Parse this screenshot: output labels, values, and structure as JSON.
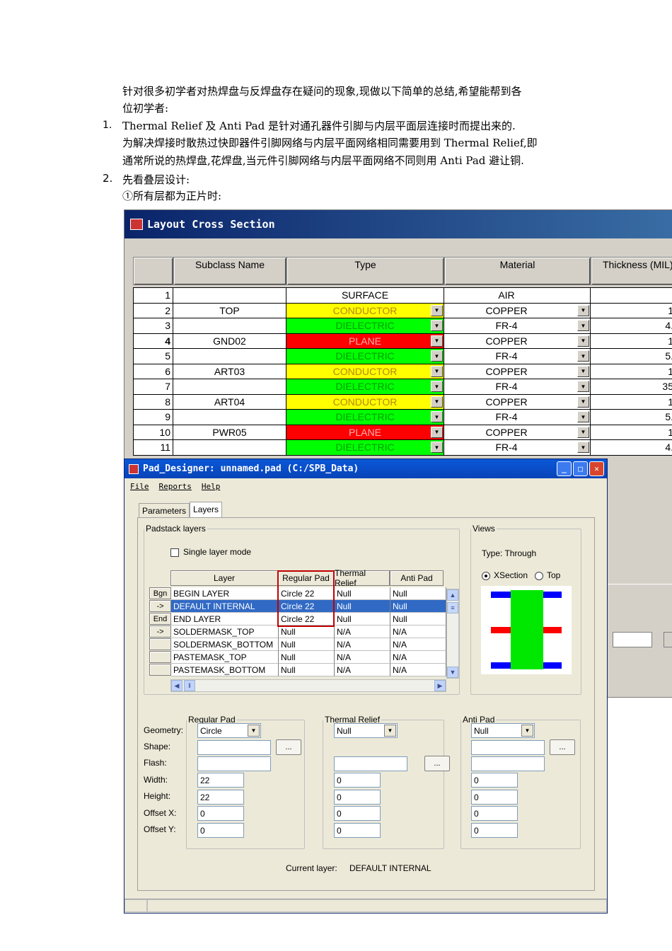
{
  "doc": {
    "line1": "针对很多初学者对热焊盘与反焊盘存在疑问的现象,现做以下简单的总结,希望能帮到各",
    "line2": "位初学者:",
    "item1_num": "1.",
    "item1_text": "Thermal Relief 及 Anti Pad 是针对通孔器件引脚与内层平面层连接时而提出来的.",
    "item1_line2": "为解决焊接时散热过快即器件引脚网络与内层平面网络相同需要用到 Thermal Relief,即",
    "item1_line3": "通常所说的热焊盘,花焊盘,当元件引脚网络与内层平面网络不同则用 Anti Pad 避让铜.",
    "item2_num": "2.",
    "item2_text": "先看叠层设计:",
    "item2_sub": "①所有层都为正片时:"
  },
  "cross_section": {
    "title": "Layout Cross Section",
    "headers": [
      "Subclass Name",
      "Type",
      "Material",
      "Thickness (MIL)"
    ],
    "rows": [
      {
        "n": "1",
        "name": "",
        "type": "SURFACE",
        "mat": "AIR",
        "thk": "",
        "color": "#ffffff"
      },
      {
        "n": "2",
        "name": "TOP",
        "type": "CONDUCTOR",
        "mat": "COPPER",
        "thk": "1",
        "color": "#ffff00"
      },
      {
        "n": "3",
        "name": "",
        "type": "DIELECTRIC",
        "mat": "FR-4",
        "thk": "4.",
        "color": "#00ff00"
      },
      {
        "n": "4",
        "name": "GND02",
        "type": "PLANE",
        "mat": "COPPER",
        "thk": "1",
        "color": "#ff0000"
      },
      {
        "n": "5",
        "name": "",
        "type": "DIELECTRIC",
        "mat": "FR-4",
        "thk": "5.",
        "color": "#00ff00"
      },
      {
        "n": "6",
        "name": "ART03",
        "type": "CONDUCTOR",
        "mat": "COPPER",
        "thk": "1",
        "color": "#ffff00"
      },
      {
        "n": "7",
        "name": "",
        "type": "DIELECTRIC",
        "mat": "FR-4",
        "thk": "35",
        "color": "#00ff00"
      },
      {
        "n": "8",
        "name": "ART04",
        "type": "CONDUCTOR",
        "mat": "COPPER",
        "thk": "1",
        "color": "#ffff00"
      },
      {
        "n": "9",
        "name": "",
        "type": "DIELECTRIC",
        "mat": "FR-4",
        "thk": "5.",
        "color": "#00ff00"
      },
      {
        "n": "10",
        "name": "PWR05",
        "type": "PLANE",
        "mat": "COPPER",
        "thk": "1",
        "color": "#ff0000"
      },
      {
        "n": "11",
        "name": "",
        "type": "DIELECTRIC",
        "mat": "FR-4",
        "thk": "4.",
        "color": "#00ff00"
      }
    ]
  },
  "pad_designer": {
    "title": "Pad_Designer: unnamed.pad (C:/SPB_Data)",
    "menu": [
      "File",
      "Reports",
      "Help"
    ],
    "tabs": [
      "Parameters",
      "Layers"
    ],
    "padstack_legend": "Padstack layers",
    "single_layer_mode": "Single layer mode",
    "table_headers": [
      "Layer",
      "Regular Pad",
      "Thermal Relief",
      "Anti Pad"
    ],
    "layers": [
      {
        "btn": "Bgn",
        "layer": "BEGIN LAYER",
        "reg": "Circle 22",
        "thermal": "Null",
        "anti": "Null"
      },
      {
        "btn": "->",
        "layer": "DEFAULT INTERNAL",
        "reg": "Circle 22",
        "thermal": "Null",
        "anti": "Null"
      },
      {
        "btn": "End",
        "layer": "END LAYER",
        "reg": "Circle 22",
        "thermal": "Null",
        "anti": "Null"
      },
      {
        "btn": "->",
        "layer": "SOLDERMASK_TOP",
        "reg": "Null",
        "thermal": "N/A",
        "anti": "N/A"
      },
      {
        "btn": "",
        "layer": "SOLDERMASK_BOTTOM",
        "reg": "Null",
        "thermal": "N/A",
        "anti": "N/A"
      },
      {
        "btn": "",
        "layer": "PASTEMASK_TOP",
        "reg": "Null",
        "thermal": "N/A",
        "anti": "N/A"
      },
      {
        "btn": "",
        "layer": "PASTEMASK_BOTTOM",
        "reg": "Null",
        "thermal": "N/A",
        "anti": "N/A"
      }
    ],
    "views_legend": "Views",
    "views_type": "Type:  Through",
    "xsection": "XSection",
    "top": "Top",
    "row_labels": [
      "Geometry:",
      "Shape:",
      "Flash:",
      "Width:",
      "Height:",
      "Offset X:",
      "Offset Y:"
    ],
    "regular": {
      "legend": "Regular Pad",
      "geometry": "Circle",
      "width": "22",
      "height": "22",
      "offx": "0",
      "offy": "0"
    },
    "thermal": {
      "legend": "Thermal Relief",
      "geometry": "Null",
      "width": "0",
      "height": "0",
      "offx": "0",
      "offy": "0"
    },
    "anti": {
      "legend": "Anti Pad",
      "geometry": "Null",
      "width": "0",
      "height": "0",
      "offx": "0",
      "offy": "0"
    },
    "ellipsis": "...",
    "current_layer_label": "Current layer:",
    "current_layer_value": "DEFAULT INTERNAL"
  }
}
